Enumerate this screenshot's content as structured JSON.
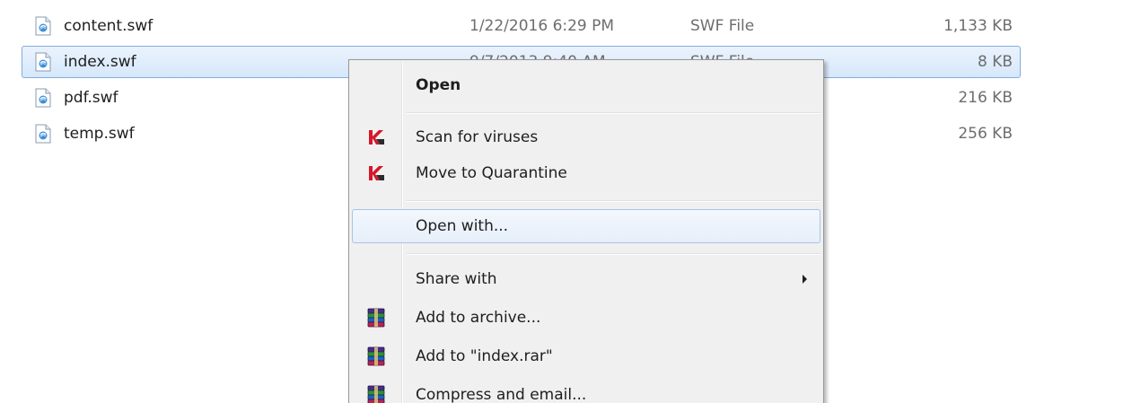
{
  "files": [
    {
      "name": "content.swf",
      "date": "1/22/2016 6:29 PM",
      "type": "SWF File",
      "size": "1,133 KB",
      "icon": "swf-file-icon"
    },
    {
      "name": "index.swf",
      "date": "9/7/2013 9:40 AM",
      "type": "SWF File",
      "size": "8 KB",
      "icon": "swf-file-icon",
      "selected": true
    },
    {
      "name": "pdf.swf",
      "date": "",
      "type": "",
      "size": "216 KB",
      "icon": "swf-file-icon"
    },
    {
      "name": "temp.swf",
      "date": "",
      "type": "",
      "size": "256 KB",
      "icon": "swf-file-icon"
    }
  ],
  "context_menu": {
    "items": [
      {
        "label": "Open",
        "bold": true
      },
      {
        "label": "Scan for viruses",
        "icon": "kaspersky-icon"
      },
      {
        "label": "Move to Quarantine",
        "icon": "kaspersky-icon"
      },
      {
        "label": "Open with...",
        "highlighted": true
      },
      {
        "label": "Share with",
        "has_submenu": true
      },
      {
        "label": "Add to archive...",
        "icon": "winrar-icon"
      },
      {
        "label": "Add to \"index.rar\"",
        "icon": "winrar-icon"
      },
      {
        "label": "Compress and email...",
        "icon": "winrar-icon"
      }
    ]
  },
  "colors": {
    "selection_border": "#84acdd",
    "menu_background": "#f0f0f0",
    "kaspersky_red": "#d4172b"
  }
}
